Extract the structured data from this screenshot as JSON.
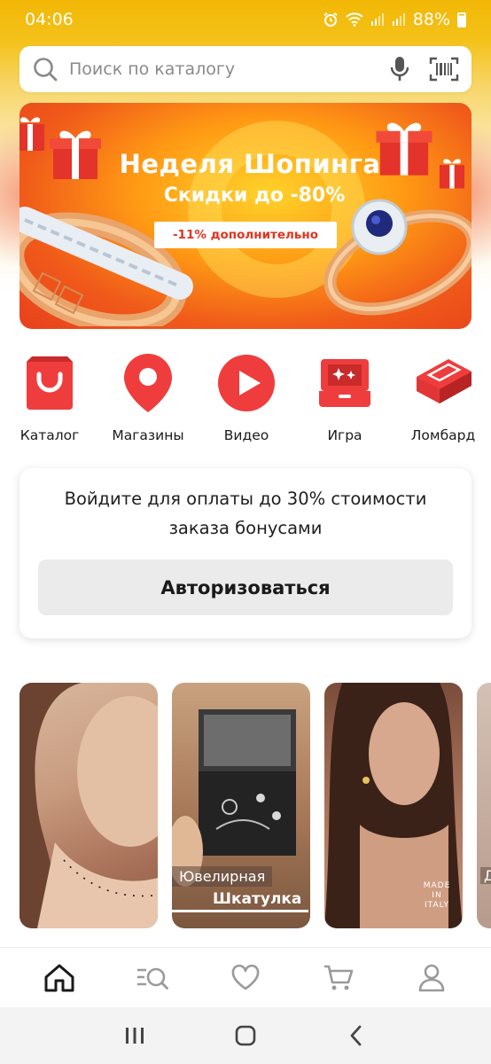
{
  "status_bar": {
    "time": "04:06",
    "battery": "88%"
  },
  "search": {
    "placeholder": "Поиск по каталогу"
  },
  "banner": {
    "title": "Неделя Шопинга",
    "subtitle": "Скидки до -80%",
    "tag": "-11% дополнительно"
  },
  "quick_links": [
    {
      "label": "Каталог",
      "icon": "shopping-bag-icon"
    },
    {
      "label": "Магазины",
      "icon": "map-pin-icon"
    },
    {
      "label": "Видео",
      "icon": "play-icon"
    },
    {
      "label": "Игра",
      "icon": "gift-box-icon"
    },
    {
      "label": "Ломбард",
      "icon": "money-stack-icon"
    }
  ],
  "login_card": {
    "message": "Войдите для оплаты до 30% стоимости заказа бонусами",
    "button": "Авторизоваться"
  },
  "stories": [
    {
      "caption_line1": "",
      "caption_line2": ""
    },
    {
      "caption_line1": "Ювелирная",
      "caption_line2": "Шкатулка"
    },
    {
      "caption_line1": "",
      "caption_line2": "",
      "badge": "MADE IN ITALY"
    },
    {
      "caption_line1": "Д",
      "caption_line2": ""
    }
  ],
  "bottom_nav": [
    {
      "name": "home-icon",
      "active": true
    },
    {
      "name": "catalog-search-icon"
    },
    {
      "name": "heart-icon"
    },
    {
      "name": "cart-icon"
    },
    {
      "name": "profile-icon"
    }
  ],
  "colors": {
    "brand_red": "#ef3d3d",
    "banner_orange": "#ff8a14",
    "status_yellow": "#f2b705"
  }
}
